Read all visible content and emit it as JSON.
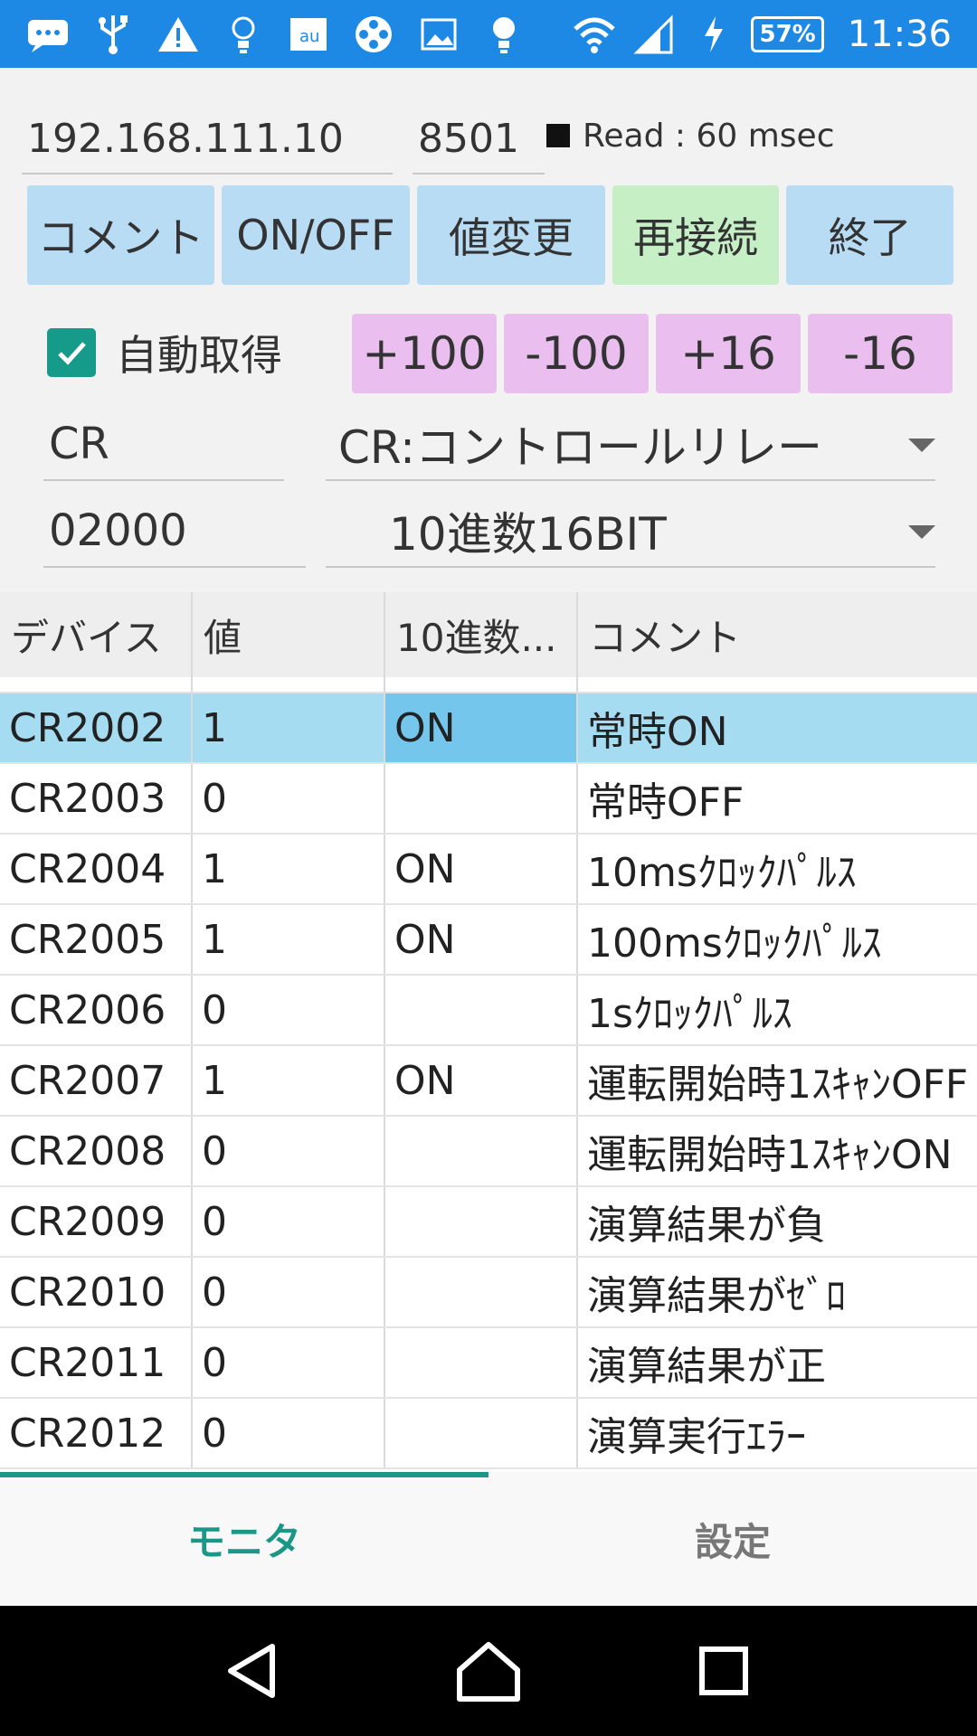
{
  "status_bar": {
    "battery": "57%",
    "time": "11:36",
    "icons": [
      "chat-bubble-icon",
      "usb-icon",
      "warning-icon",
      "lightbulb-icon",
      "au-icon",
      "film-reel-icon",
      "image-icon",
      "bulb-icon"
    ],
    "right_icons": [
      "wifi-icon",
      "signal-icon",
      "charging-icon"
    ],
    "color": "#1e88e5"
  },
  "connection": {
    "ip": "192.168.111.10",
    "port": "8501",
    "read_status": "Read : 60 msec"
  },
  "toolbar": {
    "comment": "コメント",
    "on_off": "ON/OFF",
    "change_value": "値変更",
    "reconnect": "再接続",
    "exit": "終了"
  },
  "auto": {
    "label": "自動取得",
    "checked": true,
    "accent": "#169a8a"
  },
  "step_buttons": [
    "+100",
    "-100",
    "+16",
    "-16"
  ],
  "device": {
    "type_value": "CR",
    "type_select": "CR:コントロールリレー",
    "address_value": "02000",
    "format_select": "10進数16BIT"
  },
  "table": {
    "headers": [
      "デバイス",
      "値",
      "10進数...",
      "コメント"
    ],
    "rows": [
      {
        "device": "CR2002",
        "value": "1",
        "dec": "ON",
        "comment": "常時ON"
      },
      {
        "device": "CR2003",
        "value": "0",
        "dec": "",
        "comment": "常時OFF"
      },
      {
        "device": "CR2004",
        "value": "1",
        "dec": "ON",
        "comment": "10msｸﾛｯｸﾊﾟﾙｽ"
      },
      {
        "device": "CR2005",
        "value": "1",
        "dec": "ON",
        "comment": "100msｸﾛｯｸﾊﾟﾙｽ"
      },
      {
        "device": "CR2006",
        "value": "0",
        "dec": "",
        "comment": "1sｸﾛｯｸﾊﾟﾙｽ"
      },
      {
        "device": "CR2007",
        "value": "1",
        "dec": "ON",
        "comment": "運転開始時1ｽｷｬﾝOFF"
      },
      {
        "device": "CR2008",
        "value": "0",
        "dec": "",
        "comment": "運転開始時1ｽｷｬﾝON"
      },
      {
        "device": "CR2009",
        "value": "0",
        "dec": "",
        "comment": "演算結果が負"
      },
      {
        "device": "CR2010",
        "value": "0",
        "dec": "",
        "comment": "演算結果がｾﾞﾛ"
      },
      {
        "device": "CR2011",
        "value": "0",
        "dec": "",
        "comment": "演算結果が正"
      },
      {
        "device": "CR2012",
        "value": "0",
        "dec": "",
        "comment": "演算実行ｴﾗｰ"
      }
    ],
    "selected_row": 0
  },
  "tabs": {
    "monitor": "モニタ",
    "settings": "設定",
    "active": "monitor"
  }
}
